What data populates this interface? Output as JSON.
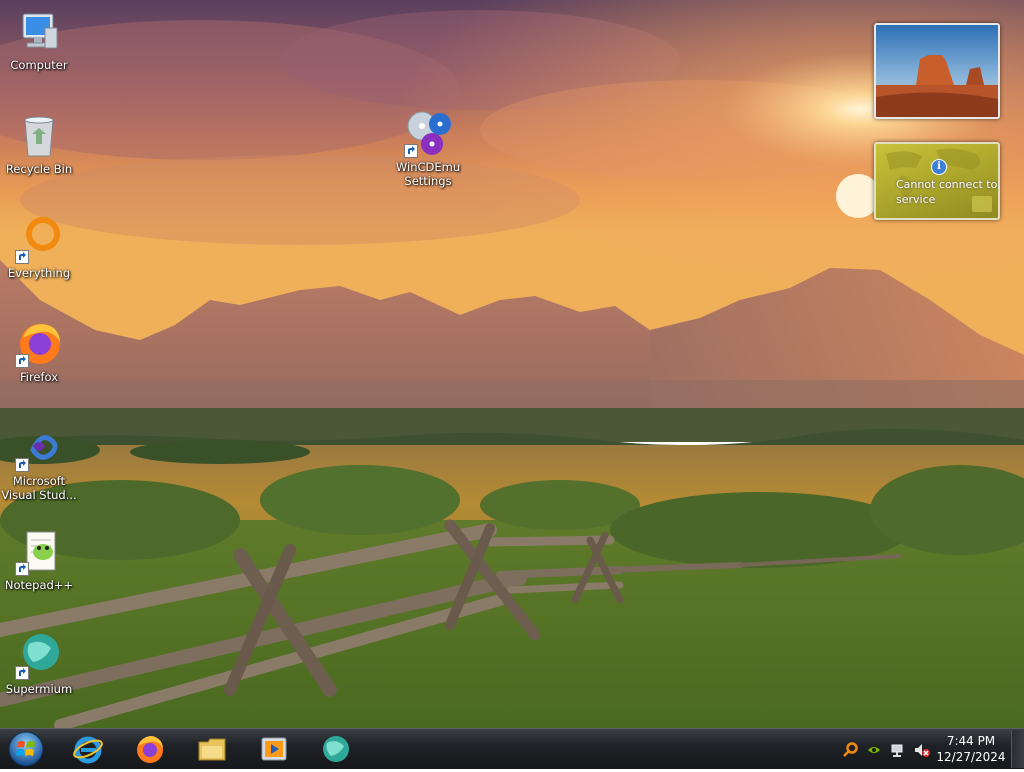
{
  "desktop": {
    "icons": [
      {
        "label": "Computer"
      },
      {
        "label": "Recycle Bin"
      },
      {
        "label": "Everything"
      },
      {
        "label": "Firefox"
      },
      {
        "label": "Microsoft Visual Stud..."
      },
      {
        "label": "Notepad++"
      },
      {
        "label": "Supermium"
      },
      {
        "label": "WinCDEmu Settings"
      }
    ]
  },
  "gadgets": {
    "weather": {
      "message": "Cannot connect to service",
      "info_glyph": "i"
    }
  },
  "taskbar": {
    "pinned": [
      {
        "icon": "internet-explorer-icon"
      },
      {
        "icon": "firefox-icon"
      },
      {
        "icon": "file-explorer-icon"
      },
      {
        "icon": "media-player-icon"
      },
      {
        "icon": "supermium-icon"
      }
    ],
    "clock": {
      "time": "7:44 PM",
      "date": "12/27/2024"
    }
  },
  "colors": {
    "taskbar": "#1f2226",
    "weather_gadget": "#b3ac2f",
    "sky_top": "#6b4a6a",
    "sun": "#ffd07a"
  }
}
